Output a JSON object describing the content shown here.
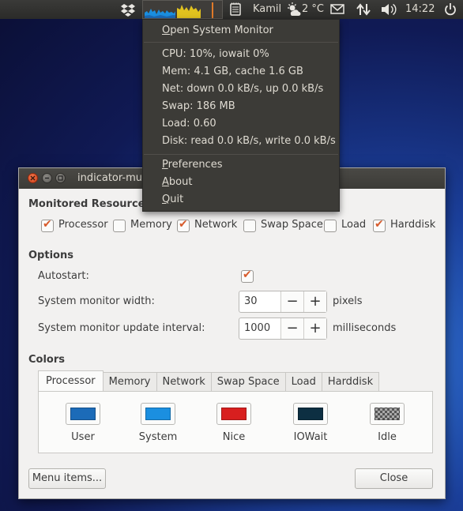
{
  "panel": {
    "username": "Kamil",
    "temperature": "2 °C",
    "time": "14:22",
    "icons": [
      "dropbox-icon",
      "system-monitor-graph",
      "indicator-notes-icon",
      "weather-icon",
      "mail-icon",
      "network-transfer-icon",
      "volume-icon",
      "power-icon"
    ]
  },
  "menu": {
    "open_system_monitor": "Open System Monitor",
    "cpu": "CPU: 10%, iowait 0%",
    "mem": "Mem: 4.1 GB, cache 1.6 GB",
    "net": "Net: down 0.0 kB/s, up 0.0 kB/s",
    "swap": "Swap: 186 MB",
    "load": "Load: 0.60",
    "disk": "Disk: read 0.0 kB/s, write 0.0 kB/s",
    "preferences": "Preferences",
    "about": "About",
    "quit": "Quit"
  },
  "window": {
    "title": "indicator-mu",
    "monitored_resources": {
      "heading": "Monitored Resources",
      "items": [
        {
          "label": "Processor",
          "checked": true
        },
        {
          "label": "Memory",
          "checked": false
        },
        {
          "label": "Network",
          "checked": true
        },
        {
          "label": "Swap Space",
          "checked": false
        },
        {
          "label": "Load",
          "checked": false
        },
        {
          "label": "Harddisk",
          "checked": true
        }
      ]
    },
    "options": {
      "heading": "Options",
      "autostart_label": "Autostart:",
      "autostart_checked": true,
      "width_label": "System monitor width:",
      "width_value": "30",
      "width_unit": "pixels",
      "interval_label": "System monitor update interval:",
      "interval_value": "1000",
      "interval_unit": "milliseconds",
      "minus": "−",
      "plus": "+"
    },
    "colors": {
      "heading": "Colors",
      "tabs": [
        "Processor",
        "Memory",
        "Network",
        "Swap Space",
        "Load",
        "Harddisk"
      ],
      "active_tab": "Processor",
      "swatches": [
        {
          "label": "User",
          "color": "#1c6bb8"
        },
        {
          "label": "System",
          "color": "#1b8fe0"
        },
        {
          "label": "Nice",
          "color": "#d81f1f"
        },
        {
          "label": "IOWait",
          "color": "#0d2f42"
        },
        {
          "label": "Idle",
          "color": "checkerboard"
        }
      ]
    },
    "menu_items_button": "Menu items...",
    "close_button": "Close"
  }
}
